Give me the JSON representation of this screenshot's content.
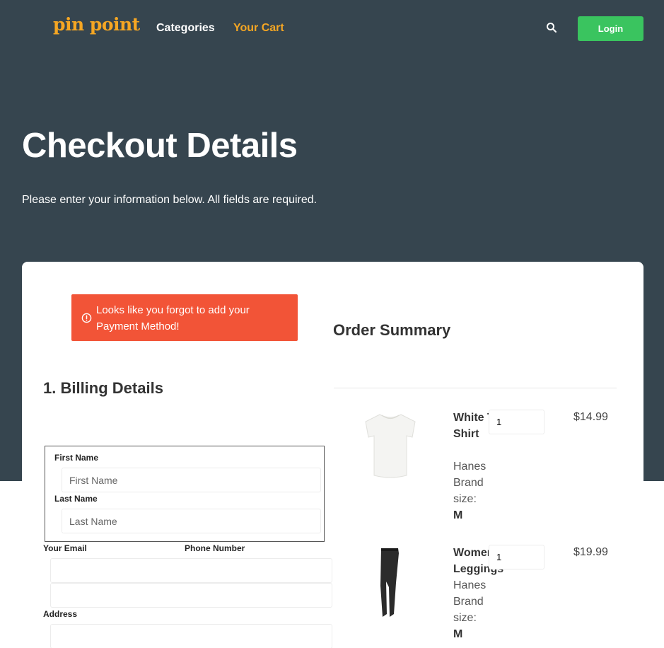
{
  "nav": {
    "logo": "pin point",
    "categories": "Categories",
    "cart": "Your Cart",
    "login": "Login",
    "search_icon": "search-icon"
  },
  "hero": {
    "title": "Checkout Details",
    "subtitle": "Please enter your information below. All fields are required."
  },
  "alert": {
    "icon": "alert-circle-icon",
    "message": "Looks like you forgot to add your Payment Method!"
  },
  "billing": {
    "title": "1. Billing Details",
    "first_name_label": "First Name",
    "first_name_placeholder": "First Name",
    "first_name_value": "",
    "last_name_label": "Last Name",
    "last_name_placeholder": "Last Name",
    "last_name_value": "",
    "email_label": "Your Email",
    "email_value": "",
    "phone_label": "Phone Number",
    "phone_value": "",
    "address_label": "Address",
    "address_value": ""
  },
  "order": {
    "title": "Order Summary",
    "items": [
      {
        "name": "White T-Shirt",
        "brand": "Hanes Brand",
        "size_label": "size:",
        "size": "M",
        "qty": "1",
        "price": "$14.99"
      },
      {
        "name": "Women Leggings",
        "brand": "Hanes Brand",
        "size_label": "size:",
        "size": "M",
        "qty": "1",
        "price": "$19.99"
      }
    ]
  },
  "colors": {
    "hero_bg": "#36454f",
    "brand_accent": "#f5a623",
    "login_green": "#3ac45f",
    "alert_red": "#f25437"
  }
}
